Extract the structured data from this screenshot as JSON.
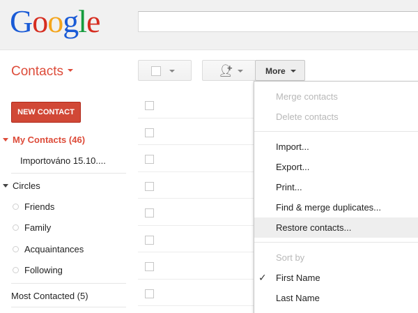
{
  "brand": {
    "logo_letters": [
      "G",
      "o",
      "o",
      "g",
      "l",
      "e"
    ],
    "logo_colors": [
      "#1a5bd6",
      "#d62d20",
      "#f4a51c",
      "#1a5bd6",
      "#159b3d",
      "#d62d20"
    ]
  },
  "header": {
    "app_title": "Contacts"
  },
  "toolbar": {
    "more_label": "More"
  },
  "sidebar": {
    "new_contact_label": "NEW CONTACT",
    "my_contacts_label": "My Contacts (46)",
    "imported_group_label": "Importováno 15.10....",
    "circles_label": "Circles",
    "circles": [
      "Friends",
      "Family",
      "Acquaintances",
      "Following"
    ],
    "most_contacted_label": "Most Contacted (5)"
  },
  "contacts": {
    "row_count": 8
  },
  "more_menu": {
    "merge": "Merge contacts",
    "delete": "Delete contacts",
    "import": "Import...",
    "export": "Export...",
    "print": "Print...",
    "find_merge": "Find & merge duplicates...",
    "restore": "Restore contacts...",
    "sort_by": "Sort by",
    "first_name": "First Name",
    "last_name": "Last Name",
    "check_glyph": "✓"
  },
  "colors": {
    "accent_red": "#dd4b39",
    "button_red": "#d14836",
    "menu_hover": "#eeeeee",
    "disabled_text": "#b8b8b8"
  }
}
